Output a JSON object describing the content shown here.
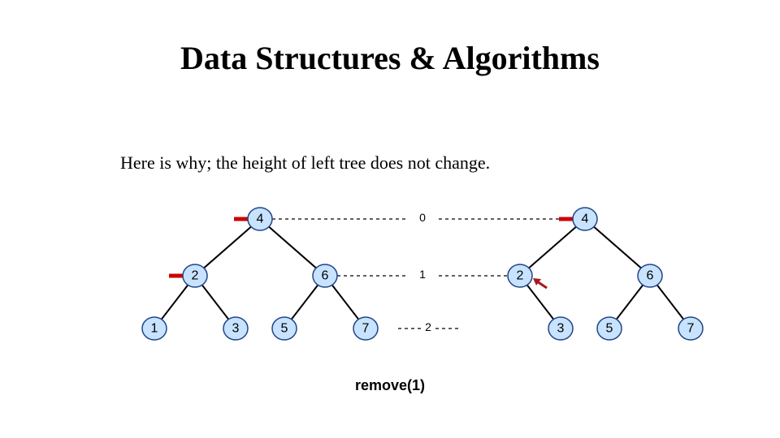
{
  "title": "Data Structures & Algorithms",
  "subtitle": "Here is why; the height of left tree does not change.",
  "caption": "remove(1)",
  "levels": {
    "l0": "0",
    "l1": "1",
    "l2": "2"
  },
  "left_tree": {
    "root": "4",
    "n2": "2",
    "n6": "6",
    "n1": "1",
    "n3": "3",
    "n5": "5",
    "n7": "7"
  },
  "right_tree": {
    "root": "4",
    "n2": "2",
    "n6": "6",
    "n3": "3",
    "n5": "5",
    "n7": "7"
  }
}
